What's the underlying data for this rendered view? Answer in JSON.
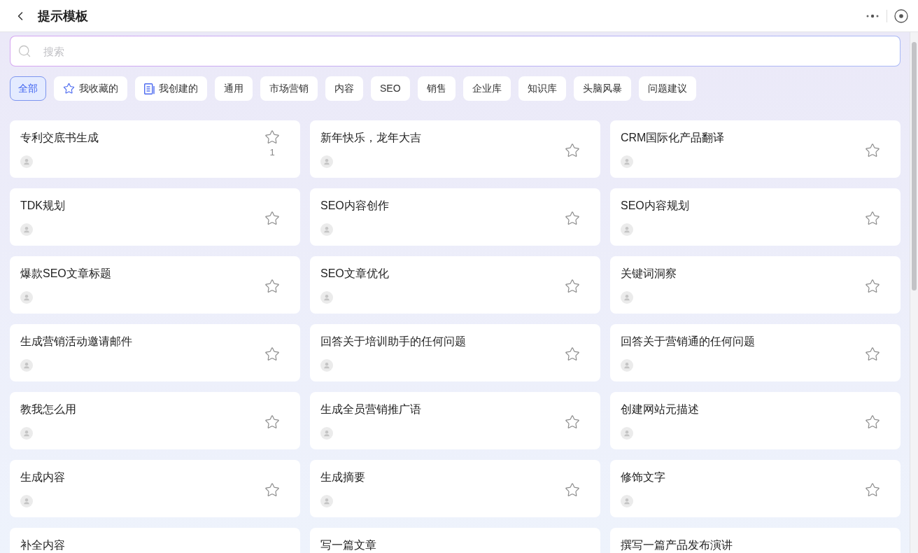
{
  "header": {
    "title": "提示模板"
  },
  "search": {
    "placeholder": "搜索"
  },
  "filters": [
    {
      "label": "全部",
      "selected": true,
      "kind": "plain"
    },
    {
      "label": "我收藏的",
      "selected": false,
      "kind": "starred"
    },
    {
      "label": "我创建的",
      "selected": false,
      "kind": "mine"
    },
    {
      "label": "通用",
      "selected": false,
      "kind": "plain"
    },
    {
      "label": "市场营销",
      "selected": false,
      "kind": "plain"
    },
    {
      "label": "内容",
      "selected": false,
      "kind": "plain"
    },
    {
      "label": "SEO",
      "selected": false,
      "kind": "plain"
    },
    {
      "label": "销售",
      "selected": false,
      "kind": "plain"
    },
    {
      "label": "企业库",
      "selected": false,
      "kind": "plain"
    },
    {
      "label": "知识库",
      "selected": false,
      "kind": "plain"
    },
    {
      "label": "头脑风暴",
      "selected": false,
      "kind": "plain"
    },
    {
      "label": "问题建议",
      "selected": false,
      "kind": "plain"
    }
  ],
  "cards": [
    {
      "title": "专利交底书生成",
      "count": "1",
      "cut_off": false
    },
    {
      "title": "新年快乐，龙年大吉",
      "cut_off": false
    },
    {
      "title": "CRM国际化产品翻译",
      "cut_off": false
    },
    {
      "title": "TDK规划",
      "cut_off": false
    },
    {
      "title": "SEO内容创作",
      "cut_off": false
    },
    {
      "title": "SEO内容规划",
      "cut_off": false
    },
    {
      "title": "爆款SEO文章标题",
      "cut_off": false
    },
    {
      "title": "SEO文章优化",
      "cut_off": false
    },
    {
      "title": "关键词洞察",
      "cut_off": false
    },
    {
      "title": "生成营销活动邀请邮件",
      "cut_off": false
    },
    {
      "title": "回答关于培训助手的任何问题",
      "cut_off": false
    },
    {
      "title": "回答关于营销通的任何问题",
      "cut_off": false
    },
    {
      "title": "教我怎么用",
      "cut_off": false
    },
    {
      "title": "生成全员营销推广语",
      "cut_off": false
    },
    {
      "title": "创建网站元描述",
      "cut_off": false
    },
    {
      "title": "生成内容",
      "cut_off": false
    },
    {
      "title": "生成摘要",
      "cut_off": false
    },
    {
      "title": "修饰文字",
      "cut_off": false
    },
    {
      "title": "补全内容",
      "cut_off": true
    },
    {
      "title": "写一篇文章",
      "cut_off": true
    },
    {
      "title": "撰写一篇产品发布演讲",
      "cut_off": true
    }
  ]
}
